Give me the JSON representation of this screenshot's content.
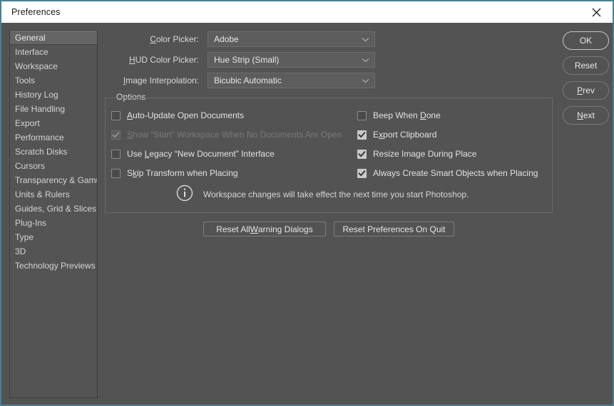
{
  "window": {
    "title": "Preferences",
    "close_icon": "close-icon",
    "frame_color": "#4a7f92",
    "background_color": "#535353"
  },
  "sidebar": {
    "items": [
      {
        "label": "General",
        "selected": true
      },
      {
        "label": "Interface",
        "selected": false
      },
      {
        "label": "Workspace",
        "selected": false
      },
      {
        "label": "Tools",
        "selected": false
      },
      {
        "label": "History Log",
        "selected": false
      },
      {
        "label": "File Handling",
        "selected": false
      },
      {
        "label": "Export",
        "selected": false
      },
      {
        "label": "Performance",
        "selected": false
      },
      {
        "label": "Scratch Disks",
        "selected": false
      },
      {
        "label": "Cursors",
        "selected": false
      },
      {
        "label": "Transparency & Gamut",
        "selected": false
      },
      {
        "label": "Units & Rulers",
        "selected": false
      },
      {
        "label": "Guides, Grid & Slices",
        "selected": false
      },
      {
        "label": "Plug-Ins",
        "selected": false
      },
      {
        "label": "Type",
        "selected": false
      },
      {
        "label": "3D",
        "selected": false
      },
      {
        "label": "Technology Previews",
        "selected": false
      }
    ]
  },
  "fields": [
    {
      "label_pre": "",
      "label_accel": "C",
      "label_post": "olor Picker:",
      "value": "Adobe"
    },
    {
      "label_pre": "",
      "label_accel": "H",
      "label_post": "UD Color Picker:",
      "value": "Hue Strip (Small)"
    },
    {
      "label_pre": "",
      "label_accel": "I",
      "label_post": "mage Interpolation:",
      "value": "Bicubic Automatic"
    }
  ],
  "options": {
    "legend": "Options",
    "left_column": [
      {
        "pre": "",
        "accel": "A",
        "post": "uto-Update Open Documents",
        "checked": false,
        "disabled": false
      },
      {
        "pre": "",
        "accel": "S",
        "post": "how “Start” Workspace When No Documents Are Open",
        "checked": true,
        "disabled": true
      },
      {
        "pre": "Use ",
        "accel": "L",
        "post": "egacy “New Document” Interface",
        "checked": false,
        "disabled": false
      },
      {
        "pre": "S",
        "accel": "k",
        "post": "ip Transform when Placing",
        "checked": false,
        "disabled": false
      }
    ],
    "right_column": [
      {
        "pre": "Beep When ",
        "accel": "D",
        "post": "one",
        "checked": false,
        "disabled": false
      },
      {
        "pre": "E",
        "accel": "x",
        "post": "port Clipboard",
        "checked": true,
        "disabled": false
      },
      {
        "pre": "Resize Ima",
        "accel": "g",
        "post": "e During Place",
        "checked": true,
        "disabled": false
      },
      {
        "pre": "Always Create Smart Ob",
        "accel": "j",
        "post": "ects when Placing",
        "checked": true,
        "disabled": false
      }
    ],
    "note": {
      "icon": "info-icon",
      "text": "Workspace changes will take effect the next time you start Photoshop."
    }
  },
  "bottom_buttons": [
    {
      "pre": "Reset All ",
      "accel": "W",
      "post": "arning Dialogs"
    },
    {
      "pre": "Reset Preferences On Quit",
      "accel": "",
      "post": ""
    }
  ],
  "action_buttons": [
    {
      "pre": "OK",
      "accel": "",
      "post": "",
      "primary": true
    },
    {
      "pre": "Reset",
      "accel": "",
      "post": "",
      "primary": false
    },
    {
      "pre": "",
      "accel": "P",
      "post": "rev",
      "primary": false
    },
    {
      "pre": "",
      "accel": "N",
      "post": "ext",
      "primary": false
    }
  ]
}
